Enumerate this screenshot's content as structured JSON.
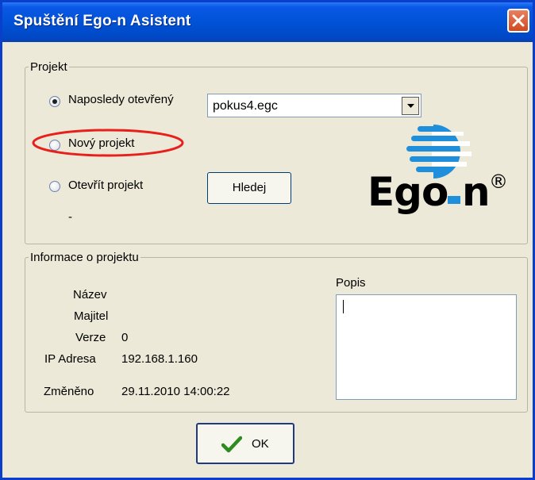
{
  "window": {
    "title": "Spuštění Ego-n Asistent"
  },
  "project": {
    "legend": "Projekt",
    "options": {
      "last": "Naposledy otevřený",
      "new": "Nový projekt",
      "open": "Otevřít projekt"
    },
    "selected": "last",
    "combo_value": "pokus4.egc",
    "search_button": "Hledej",
    "path_text": "-"
  },
  "logo": {
    "text_left": "Ego",
    "text_right": "n",
    "reg": "®"
  },
  "info": {
    "legend": "Informace o projektu",
    "labels": {
      "name": "Název",
      "owner": "Majitel",
      "version": "Verze",
      "ip": "IP Adresa",
      "changed": "Změněno"
    },
    "values": {
      "name": "",
      "owner": "",
      "version": "0",
      "ip": "192.168.1.160",
      "changed": "29.11.2010 14:00:22"
    },
    "description_label": "Popis",
    "description_value": ""
  },
  "ok_button": "OK",
  "colors": {
    "title_blue": "#0052d6",
    "window_bg": "#ece9d8",
    "logo_blue": "#1f8fdc",
    "annotation_red": "#e8201c"
  }
}
